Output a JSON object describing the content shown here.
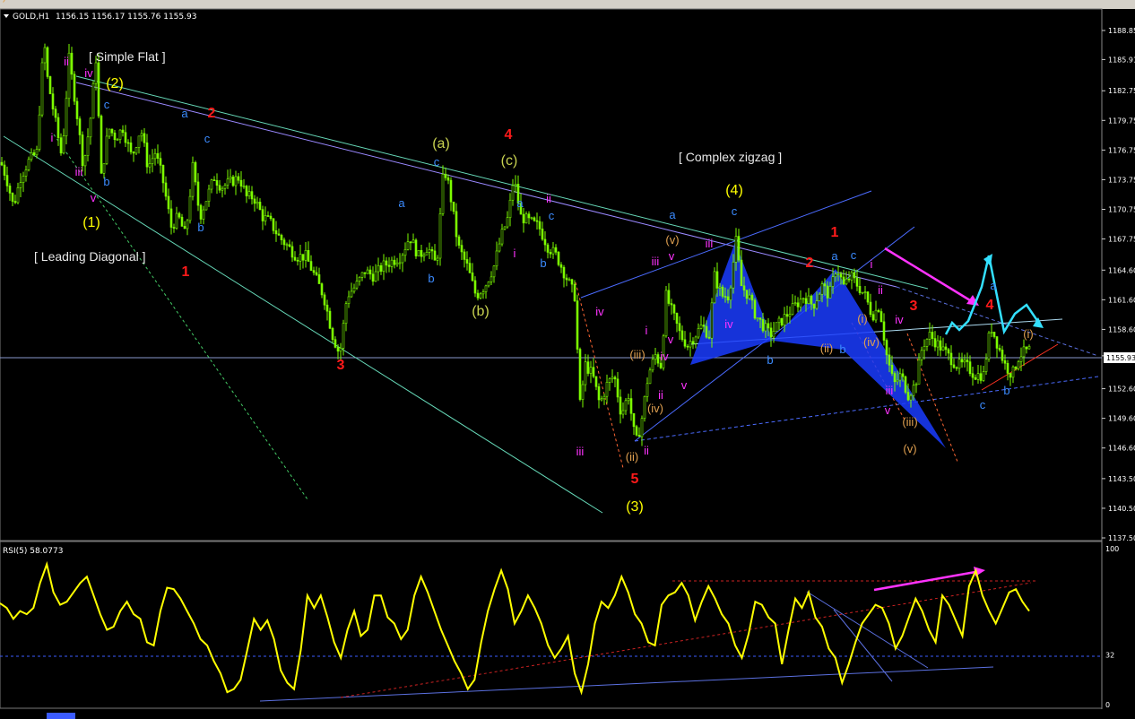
{
  "chart_header": {
    "symbol_label": "GOLD,H1",
    "ohlc": "1156.15 1156.17 1155.76 1155.93"
  },
  "colors": {
    "background": "#000000",
    "candle": "#7CFC00",
    "rsi": "#ffff00",
    "wave_blue": "#3b8bff",
    "wave_red": "#ff1a1a",
    "wave_yellow": "#ffff00",
    "wave_olive": "#c8d250",
    "wave_magenta": "#ff33ff",
    "wave_orange": "#e0a050",
    "pattern_fill": "#0033ff",
    "arrow_cyan": "#33e0ff",
    "arrow_magenta": "#ff33ff"
  },
  "chart_data": [
    {
      "type": "candlestick",
      "title": "GOLD,H1",
      "yticks": [
        "1188.85",
        "1185.91",
        "1182.75",
        "1179.75",
        "1176.75",
        "1173.75",
        "1170.75",
        "1167.75",
        "1164.60",
        "1161.60",
        "1158.60",
        "1155.93",
        "1152.60",
        "1149.60",
        "1146.60",
        "1143.50",
        "1140.50",
        "1137.50"
      ],
      "ylim": [
        1137.5,
        1188.85
      ],
      "current_price": 1155.93,
      "price_path": [
        [
          0,
          1175.5
        ],
        [
          6,
          1174
        ],
        [
          14,
          1171
        ],
        [
          22,
          1174
        ],
        [
          30,
          1175.5
        ],
        [
          40,
          1176.5
        ],
        [
          48,
          1188
        ],
        [
          52,
          1184
        ],
        [
          60,
          1180
        ],
        [
          68,
          1176
        ],
        [
          76,
          1186
        ],
        [
          84,
          1181
        ],
        [
          92,
          1175
        ],
        [
          100,
          1180
        ],
        [
          106,
          1186
        ],
        [
          112,
          1174
        ],
        [
          120,
          1179
        ],
        [
          128,
          1178
        ],
        [
          136,
          1179
        ],
        [
          146,
          1176
        ],
        [
          156,
          1179
        ],
        [
          164,
          1175
        ],
        [
          172,
          1176.5
        ],
        [
          180,
          1174
        ],
        [
          190,
          1169
        ],
        [
          198,
          1170
        ],
        [
          206,
          1168
        ],
        [
          214,
          1175
        ],
        [
          222,
          1170
        ],
        [
          230,
          1172
        ],
        [
          238,
          1174
        ],
        [
          246,
          1173
        ],
        [
          256,
          1173.5
        ],
        [
          266,
          1174
        ],
        [
          274,
          1172
        ],
        [
          282,
          1172
        ],
        [
          292,
          1170
        ],
        [
          300,
          1169.5
        ],
        [
          310,
          1168
        ],
        [
          320,
          1167
        ],
        [
          330,
          1166
        ],
        [
          340,
          1166
        ],
        [
          350,
          1164
        ],
        [
          360,
          1162
        ],
        [
          370,
          1158
        ],
        [
          378,
          1156
        ],
        [
          386,
          1162
        ],
        [
          396,
          1163
        ],
        [
          406,
          1164.5
        ],
        [
          416,
          1164
        ],
        [
          426,
          1165
        ],
        [
          436,
          1165.5
        ],
        [
          446,
          1166
        ],
        [
          456,
          1168
        ],
        [
          466,
          1166
        ],
        [
          476,
          1167
        ],
        [
          486,
          1165
        ],
        [
          494,
          1175
        ],
        [
          500,
          1173
        ],
        [
          510,
          1167
        ],
        [
          520,
          1165
        ],
        [
          530,
          1162
        ],
        [
          540,
          1163
        ],
        [
          550,
          1165
        ],
        [
          558,
          1168
        ],
        [
          566,
          1170
        ],
        [
          572,
          1174
        ],
        [
          580,
          1170
        ],
        [
          590,
          1169.5
        ],
        [
          600,
          1169
        ],
        [
          610,
          1167
        ],
        [
          620,
          1166
        ],
        [
          630,
          1164
        ],
        [
          640,
          1162
        ],
        [
          646,
          1151
        ],
        [
          652,
          1155
        ],
        [
          660,
          1154
        ],
        [
          668,
          1151
        ],
        [
          676,
          1153
        ],
        [
          684,
          1154
        ],
        [
          692,
          1150
        ],
        [
          700,
          1152
        ],
        [
          708,
          1147
        ],
        [
          714,
          1149
        ],
        [
          722,
          1154
        ],
        [
          730,
          1156
        ],
        [
          736,
          1155
        ],
        [
          742,
          1162
        ],
        [
          750,
          1160
        ],
        [
          758,
          1158
        ],
        [
          766,
          1157
        ],
        [
          774,
          1158
        ],
        [
          782,
          1159
        ],
        [
          790,
          1158
        ],
        [
          796,
          1164
        ],
        [
          804,
          1162
        ],
        [
          812,
          1162
        ],
        [
          820,
          1167.5
        ],
        [
          826,
          1163
        ],
        [
          834,
          1162
        ],
        [
          842,
          1160
        ],
        [
          850,
          1159
        ],
        [
          858,
          1158
        ],
        [
          866,
          1159
        ],
        [
          876,
          1160
        ],
        [
          886,
          1161
        ],
        [
          896,
          1162
        ],
        [
          906,
          1161
        ],
        [
          916,
          1163
        ],
        [
          924,
          1162
        ],
        [
          932,
          1165
        ],
        [
          940,
          1163
        ],
        [
          948,
          1164
        ],
        [
          956,
          1163
        ],
        [
          964,
          1162
        ],
        [
          972,
          1160
        ],
        [
          980,
          1161
        ],
        [
          988,
          1156
        ],
        [
          996,
          1153
        ],
        [
          1004,
          1154
        ],
        [
          1012,
          1152
        ],
        [
          1020,
          1153
        ],
        [
          1028,
          1157
        ],
        [
          1036,
          1158
        ],
        [
          1046,
          1157
        ],
        [
          1056,
          1156
        ],
        [
          1066,
          1155
        ],
        [
          1076,
          1155
        ],
        [
          1086,
          1154
        ],
        [
          1096,
          1154
        ],
        [
          1104,
          1159
        ],
        [
          1112,
          1157
        ],
        [
          1120,
          1155
        ],
        [
          1128,
          1154
        ],
        [
          1136,
          1156
        ],
        [
          1146,
          1156.5
        ]
      ]
    },
    {
      "type": "line",
      "title": "RSI(5) 58.0773",
      "yticks": [
        "100",
        "32",
        "0"
      ],
      "ylim": [
        0,
        100
      ],
      "level_line": 32,
      "values": [
        65,
        62,
        55,
        60,
        58,
        62,
        78,
        90,
        72,
        64,
        66,
        72,
        78,
        82,
        70,
        58,
        48,
        50,
        60,
        66,
        58,
        55,
        40,
        38,
        60,
        75,
        74,
        68,
        60,
        52,
        42,
        38,
        28,
        20,
        8,
        10,
        16,
        35,
        55,
        48,
        54,
        42,
        22,
        14,
        10,
        35,
        70,
        62,
        70,
        56,
        40,
        30,
        48,
        60,
        44,
        48,
        70,
        70,
        56,
        52,
        42,
        48,
        70,
        82,
        72,
        60,
        48,
        38,
        28,
        20,
        10,
        16,
        40,
        60,
        74,
        86,
        74,
        52,
        60,
        70,
        62,
        52,
        38,
        30,
        36,
        44,
        20,
        8,
        26,
        52,
        66,
        62,
        70,
        82,
        72,
        58,
        52,
        40,
        38,
        64,
        70,
        72,
        78,
        70,
        54,
        66,
        76,
        68,
        58,
        52,
        38,
        30,
        45,
        66,
        64,
        56,
        52,
        26,
        48,
        68,
        62,
        72,
        56,
        50,
        36,
        30,
        14,
        26,
        40,
        52,
        58,
        64,
        62,
        52,
        36,
        44,
        56,
        68,
        60,
        48,
        40,
        70,
        64,
        54,
        44,
        76,
        86,
        70,
        60,
        52,
        62,
        72,
        74,
        66,
        60
      ],
      "divergence_arrow": "up"
    }
  ],
  "annotations": {
    "brackets": [
      "[ Simple Flat ]",
      "[ Complex zigzag ]",
      "[ Leading Diagonal ]"
    ],
    "wave_labels": [
      {
        "t": "ii",
        "c": "wave_magenta",
        "s": "sm"
      },
      {
        "t": "iv",
        "c": "wave_magenta",
        "s": "sm"
      },
      {
        "t": "(2)",
        "c": "wave_yellow",
        "s": "big"
      },
      {
        "t": "c",
        "c": "wave_blue",
        "s": "md"
      },
      {
        "t": "a",
        "c": "wave_blue",
        "s": "md"
      },
      {
        "t": "2",
        "c": "wave_red",
        "s": "red"
      },
      {
        "t": "c",
        "c": "wave_blue",
        "s": "md"
      },
      {
        "t": "i",
        "c": "wave_magenta",
        "s": "sm"
      },
      {
        "t": "iii",
        "c": "wave_magenta",
        "s": "sm"
      },
      {
        "t": "b",
        "c": "wave_blue",
        "s": "md"
      },
      {
        "t": "v",
        "c": "wave_magenta",
        "s": "sm"
      },
      {
        "t": "(1)",
        "c": "wave_yellow",
        "s": "big"
      },
      {
        "t": "b",
        "c": "wave_blue",
        "s": "md"
      },
      {
        "t": "1",
        "c": "wave_red",
        "s": "red"
      },
      {
        "t": "3",
        "c": "wave_red",
        "s": "red"
      },
      {
        "t": "a",
        "c": "wave_blue",
        "s": "md"
      },
      {
        "t": "b",
        "c": "wave_blue",
        "s": "md"
      },
      {
        "t": "(a)",
        "c": "wave_olive",
        "s": "big"
      },
      {
        "t": "c",
        "c": "wave_blue",
        "s": "md"
      },
      {
        "t": "4",
        "c": "wave_red",
        "s": "red"
      },
      {
        "t": "(c)",
        "c": "wave_olive",
        "s": "big"
      },
      {
        "t": "(b)",
        "c": "wave_olive",
        "s": "big"
      },
      {
        "t": "ii",
        "c": "wave_magenta",
        "s": "sm"
      },
      {
        "t": "a",
        "c": "wave_blue",
        "s": "md"
      },
      {
        "t": "c",
        "c": "wave_blue",
        "s": "md"
      },
      {
        "t": "i",
        "c": "wave_magenta",
        "s": "sm"
      },
      {
        "t": "b",
        "c": "wave_blue",
        "s": "md"
      },
      {
        "t": "iv",
        "c": "wave_magenta",
        "s": "sm"
      },
      {
        "t": "iii",
        "c": "wave_magenta",
        "s": "sm"
      },
      {
        "t": "5",
        "c": "wave_red",
        "s": "red"
      },
      {
        "t": "(3)",
        "c": "wave_yellow",
        "s": "big"
      },
      {
        "t": "(4)",
        "c": "wave_yellow",
        "s": "big"
      },
      {
        "t": "c",
        "c": "wave_blue",
        "s": "md"
      },
      {
        "t": "a",
        "c": "wave_blue",
        "s": "md"
      },
      {
        "t": "(v)",
        "c": "wave_orange",
        "s": "sm"
      },
      {
        "t": "iii",
        "c": "wave_magenta",
        "s": "sm"
      },
      {
        "t": "v",
        "c": "wave_magenta",
        "s": "sm"
      },
      {
        "t": "iii",
        "c": "wave_magenta",
        "s": "sm"
      },
      {
        "t": "v",
        "c": "wave_magenta",
        "s": "sm"
      },
      {
        "t": "iv",
        "c": "wave_magenta",
        "s": "sm"
      },
      {
        "t": "i",
        "c": "wave_magenta",
        "s": "sm"
      },
      {
        "t": "iv",
        "c": "wave_magenta",
        "s": "sm"
      },
      {
        "t": "(iii)",
        "c": "wave_orange",
        "s": "sm"
      },
      {
        "t": "ii",
        "c": "wave_magenta",
        "s": "sm"
      },
      {
        "t": "(iv)",
        "c": "wave_orange",
        "s": "sm"
      },
      {
        "t": "ii",
        "c": "wave_magenta",
        "s": "sm"
      },
      {
        "t": "(ii)",
        "c": "wave_orange",
        "s": "sm"
      },
      {
        "t": "v",
        "c": "wave_magenta",
        "s": "sm"
      },
      {
        "t": "b",
        "c": "wave_blue",
        "s": "md"
      },
      {
        "t": "1",
        "c": "wave_red",
        "s": "red"
      },
      {
        "t": "2",
        "c": "wave_red",
        "s": "red"
      },
      {
        "t": "a",
        "c": "wave_blue",
        "s": "md"
      },
      {
        "t": "c",
        "c": "wave_blue",
        "s": "md"
      },
      {
        "t": "(ii)",
        "c": "wave_orange",
        "s": "sm"
      },
      {
        "t": "b",
        "c": "wave_blue",
        "s": "md"
      },
      {
        "t": "(i)",
        "c": "wave_orange",
        "s": "sm"
      },
      {
        "t": "i",
        "c": "wave_magenta",
        "s": "sm"
      },
      {
        "t": "ii",
        "c": "wave_magenta",
        "s": "sm"
      },
      {
        "t": "iv",
        "c": "wave_magenta",
        "s": "sm"
      },
      {
        "t": "(iv)",
        "c": "wave_orange",
        "s": "sm"
      },
      {
        "t": "iii",
        "c": "wave_magenta",
        "s": "sm"
      },
      {
        "t": "v",
        "c": "wave_magenta",
        "s": "sm"
      },
      {
        "t": "(iii)",
        "c": "wave_orange",
        "s": "sm"
      },
      {
        "t": "(v)",
        "c": "wave_orange",
        "s": "sm"
      },
      {
        "t": "3",
        "c": "wave_red",
        "s": "red"
      },
      {
        "t": "a",
        "c": "wave_blue",
        "s": "md"
      },
      {
        "t": "4",
        "c": "wave_red",
        "s": "red"
      },
      {
        "t": "c",
        "c": "wave_blue",
        "s": "md"
      },
      {
        "t": "b",
        "c": "wave_blue",
        "s": "md"
      },
      {
        "t": "(i)",
        "c": "wave_orange",
        "s": "sm"
      },
      {
        "t": "(ii)",
        "c": "wave_orange",
        "s": "sm"
      }
    ]
  }
}
